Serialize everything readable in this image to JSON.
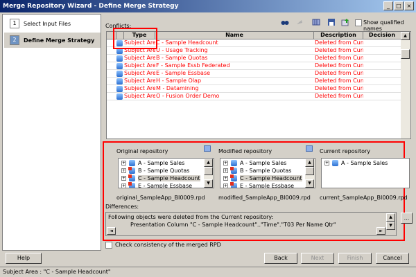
{
  "window": {
    "title": "Merge Repository Wizard - Define Merge Strategy"
  },
  "steps": [
    {
      "num": "1",
      "label": "Select Input Files",
      "current": false
    },
    {
      "num": "2",
      "label": "Define Merge Strategy",
      "current": true
    }
  ],
  "conflicts": {
    "label": "Conflicts:",
    "show_qualified_label": "Show qualified names",
    "show_qualified_checked": false,
    "columns": [
      "Type",
      "Name",
      "Description",
      "Decision"
    ],
    "rows": [
      {
        "type": "Subject Area",
        "name": "C - Sample Headcount",
        "description": "Deleted from Current",
        "decision": ""
      },
      {
        "type": "Subject Area",
        "name": "U - Usage Tracking",
        "description": "Deleted from Current",
        "decision": ""
      },
      {
        "type": "Subject Area",
        "name": "B - Sample Quotas",
        "description": "Deleted from Current",
        "decision": ""
      },
      {
        "type": "Subject Area",
        "name": "F - Sample Essb Federated",
        "description": "Deleted from Current",
        "decision": ""
      },
      {
        "type": "Subject Area",
        "name": "E - Sample Essbase",
        "description": "Deleted from Current",
        "decision": ""
      },
      {
        "type": "Subject Area",
        "name": "H - Sample Olap",
        "description": "Deleted from Current",
        "decision": ""
      },
      {
        "type": "Subject Area",
        "name": "M - Datamining",
        "description": "Deleted from Current",
        "decision": ""
      },
      {
        "type": "Subject Area",
        "name": "O - Fusion Order Demo",
        "description": "Deleted from Current",
        "decision": ""
      }
    ],
    "text_color": "#ff0000"
  },
  "repos": {
    "original": {
      "label": "Original repository",
      "file": "original_SampleApp_BI0009.rpd",
      "items": [
        "A - Sample Sales",
        "B - Sample Quotas",
        "C - Sample Headcount",
        "E - Sample Essbase"
      ]
    },
    "modified": {
      "label": "Modified repository",
      "file": "modified_SampleApp_BI0009.rpd",
      "items": [
        "A - Sample Sales",
        "B - Sample Quotas",
        "C - Sample Headcount",
        "E - Sample Essbase"
      ]
    },
    "current": {
      "label": "Current repository",
      "file": "current_SampleApp_BI0009.rpd",
      "items": [
        "A - Sample Sales"
      ]
    }
  },
  "differences": {
    "label": "Differences:",
    "line1": "Following objects were deleted from the Current repository:",
    "line2": "Presentation Column \"C - Sample Headcount\"..\"Time\".\"T03 Per Name Qtr\"",
    "more_button": "..."
  },
  "check_consistency": {
    "label": "Check consistency of the merged RPD",
    "checked": false
  },
  "buttons": {
    "help": "Help",
    "back": "Back",
    "next": "Next",
    "finish": "Finish",
    "cancel": "Cancel"
  },
  "status": "Subject Area : \"C - Sample Headcount\"",
  "highlight_color": "#ff0000"
}
